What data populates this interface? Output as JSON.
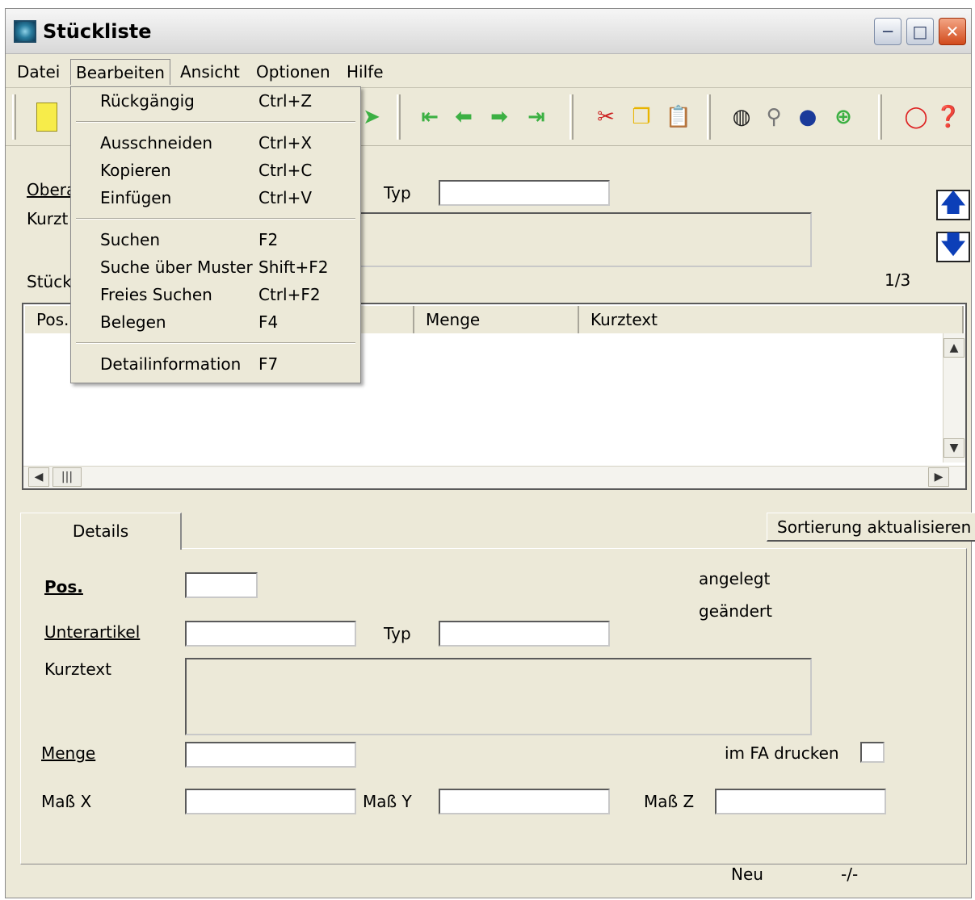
{
  "window": {
    "title": "Stückliste"
  },
  "menubar": [
    "Datei",
    "Bearbeiten",
    "Ansicht",
    "Optionen",
    "Hilfe"
  ],
  "dropdown": {
    "items": [
      {
        "label": "Rückgängig",
        "shortcut": "Ctrl+Z"
      },
      {
        "label": "Ausschneiden",
        "shortcut": "Ctrl+X"
      },
      {
        "label": "Kopieren",
        "shortcut": "Ctrl+C"
      },
      {
        "label": "Einfügen",
        "shortcut": "Ctrl+V"
      },
      {
        "label": "Suchen",
        "shortcut": "F2"
      },
      {
        "label": "Suche über Muster",
        "shortcut": "Shift+F2"
      },
      {
        "label": "Freies Suchen",
        "shortcut": "Ctrl+F2"
      },
      {
        "label": "Belegen",
        "shortcut": "F4"
      },
      {
        "label": "Detailinformation",
        "shortcut": "F7"
      }
    ]
  },
  "header": {
    "oberartikel_label": "Obera",
    "kurztext_label": "Kurzt",
    "typ_label": "Typ",
    "stueckliste_label": "Stück",
    "record_counter": "1/3"
  },
  "list": {
    "columns": [
      "Pos.",
      "Menge",
      "Kurztext"
    ]
  },
  "tab": {
    "label": "Details"
  },
  "sort_button": {
    "label": "Sortierung aktualisieren"
  },
  "details": {
    "pos_label": "Pos.",
    "unterartikel_label": "Unterartikel",
    "typ_label": "Typ",
    "kurztext_label": "Kurztext",
    "menge_label": "Menge",
    "mass_x_label": "Maß X",
    "mass_y_label": "Maß Y",
    "mass_z_label": "Maß Z",
    "angelegt_label": "angelegt",
    "geaendert_label": "geändert",
    "im_fa_drucken_label": "im FA drucken"
  },
  "status": {
    "mode": "Neu",
    "info": "-/-"
  },
  "icons": {
    "new_document": "new-document-icon",
    "first": "first-record-icon",
    "previous": "previous-record-icon",
    "next": "next-record-icon",
    "last": "last-record-icon",
    "cut": "scissors-icon",
    "copy": "copy-icon",
    "paste": "paste-icon",
    "search": "binoculars-icon",
    "zoom": "magnifier-icon",
    "refresh": "globe-icon",
    "add": "add-icon",
    "help_ring": "lifebuoy-icon",
    "help": "help-icon"
  }
}
